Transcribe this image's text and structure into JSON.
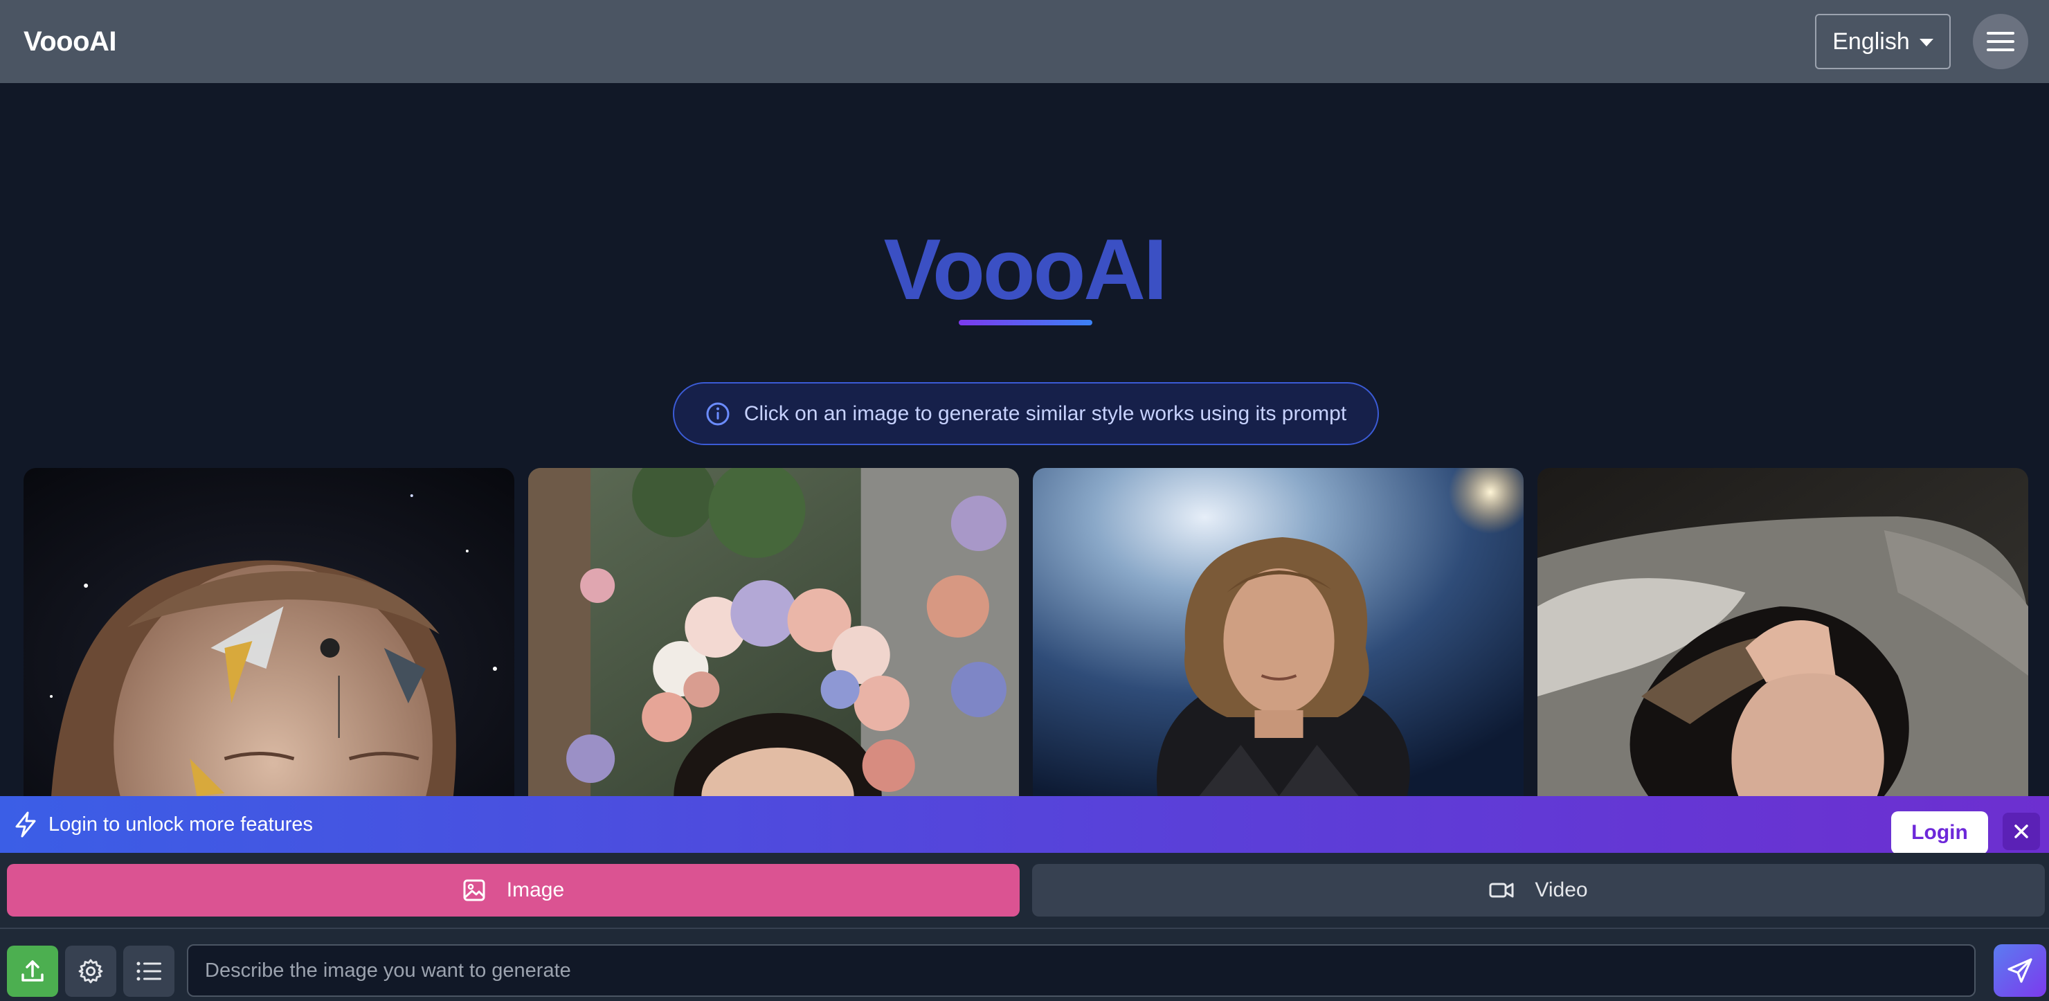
{
  "header": {
    "brand": "VoooAI",
    "language": "English"
  },
  "hero": {
    "title": "VoooAI",
    "hint": "Click on an image to generate similar style works using its prompt"
  },
  "gallery": {
    "items": [
      {
        "subject": "woman-face-geometric-art"
      },
      {
        "subject": "girl-flower-crown"
      },
      {
        "subject": "rock-singer-spotlight"
      },
      {
        "subject": "woman-on-pillow"
      }
    ]
  },
  "banner": {
    "text": "Login to unlock more features",
    "login_label": "Login"
  },
  "modes": {
    "image_label": "Image",
    "video_label": "Video",
    "active": "Image"
  },
  "composer": {
    "placeholder": "Describe the image you want to generate",
    "value": ""
  },
  "colors": {
    "accent_pink": "#db5392",
    "brand_blue": "#3b50c4",
    "upload_green": "#4caf50",
    "banner_start": "#3b5ee6",
    "banner_end": "#6d2fd0"
  },
  "icons": {
    "menu": "hamburger-icon",
    "hint": "info-icon",
    "banner": "lightning-icon",
    "close": "close-icon",
    "image_tab": "image-icon",
    "video_tab": "video-camera-icon",
    "upload": "upload-icon",
    "settings": "gear-icon",
    "list": "list-icon",
    "send": "send-icon"
  }
}
